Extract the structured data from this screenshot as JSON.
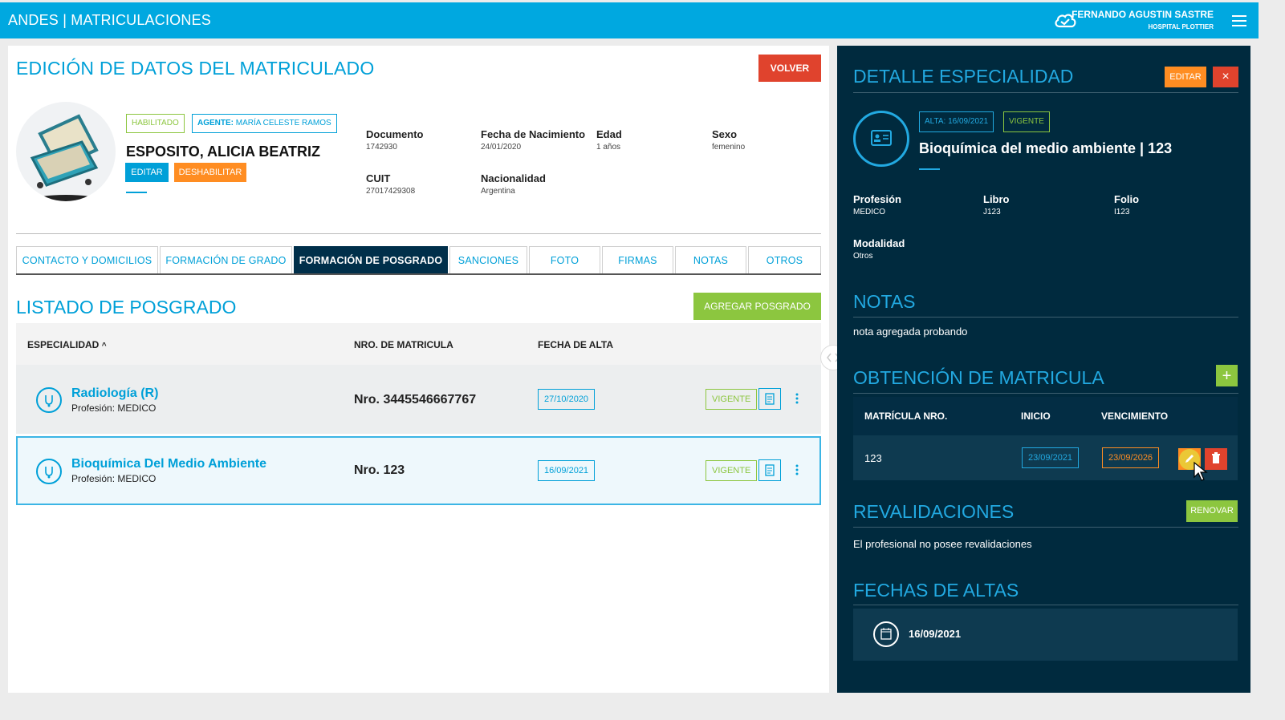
{
  "topbar": {
    "brand": "ANDES | MATRICULACIONES",
    "user_name": "FERNANDO AGUSTIN SASTRE",
    "user_org": "HOSPITAL PLOTTIER",
    "cloud_icon": "cloud-check-icon",
    "menu_icon": "hamburger-menu-icon"
  },
  "main": {
    "title": "EDICIÓN DE DATOS DEL MATRICULADO",
    "back_label": "VOLVER",
    "badges": {
      "status": "HABILITADO",
      "agent_label": "AGENTE:",
      "agent_name": "MARÍA CELESTE RAMOS"
    },
    "person_name": "ESPOSITO, ALICIA BEATRIZ",
    "edit_label": "EDITAR",
    "disable_label": "DESHABILITAR",
    "fields": {
      "documento": {
        "label": "Documento",
        "value": "1742930"
      },
      "nacimiento": {
        "label": "Fecha de Nacimiento",
        "value": "24/01/2020"
      },
      "edad": {
        "label": "Edad",
        "value": "1 años"
      },
      "sexo": {
        "label": "Sexo",
        "value": "femenino"
      },
      "cuit": {
        "label": "CUIT",
        "value": "27017429308"
      },
      "nacionalidad": {
        "label": "Nacionalidad",
        "value": "Argentina"
      }
    },
    "tabs": [
      {
        "label": "CONTACTO Y DOMICILIOS"
      },
      {
        "label": "FORMACIÓN DE GRADO"
      },
      {
        "label": "FORMACIÓN DE POSGRADO"
      },
      {
        "label": "SANCIONES"
      },
      {
        "label": "FOTO"
      },
      {
        "label": "FIRMAS"
      },
      {
        "label": "NOTAS"
      },
      {
        "label": "OTROS"
      }
    ],
    "list_title": "LISTADO DE POSGRADO",
    "add_label": "AGREGAR POSGRADO",
    "columns": {
      "especialidad": "ESPECIALIDAD",
      "sort_arrow": "^",
      "nro": "NRO. DE MATRICULA",
      "fecha": "FECHA DE ALTA"
    },
    "rows": [
      {
        "name": "Radiología (R)",
        "profesion": "Profesión: MEDICO",
        "nro": "Nro. 3445546667767",
        "fecha": "27/10/2020",
        "estado": "VIGENTE"
      },
      {
        "name": "Bioquímica Del Medio Ambiente",
        "profesion": "Profesión: MEDICO",
        "nro": "Nro. 123",
        "fecha": "16/09/2021",
        "estado": "VIGENTE"
      }
    ]
  },
  "detail": {
    "title": "DETALLE ESPECIALIDAD",
    "edit_label": "EDITAR",
    "close_label": "×",
    "alta_badge": "ALTA: 16/09/2021",
    "estado_badge": "VIGENTE",
    "specialty_title": "Bioquímica del medio ambiente | 123",
    "fields": {
      "profesion": {
        "label": "Profesión",
        "value": "MEDICO"
      },
      "libro": {
        "label": "Libro",
        "value": "J123"
      },
      "folio": {
        "label": "Folio",
        "value": "I123"
      },
      "modalidad": {
        "label": "Modalidad",
        "value": "Otros"
      }
    },
    "notas_title": "NOTAS",
    "nota_text": "nota agregada probando",
    "obtencion_title": "OBTENCIÓN DE MATRICULA",
    "add_symbol": "+",
    "mat_columns": {
      "nro": "MATRÍCULA NRO.",
      "inicio": "INICIO",
      "venc": "VENCIMIENTO"
    },
    "mat_row": {
      "nro": "123",
      "inicio": "23/09/2021",
      "venc": "23/09/2026"
    },
    "reval_title": "REVALIDACIONES",
    "renovar_label": "RENOVAR",
    "reval_text": "El profesional no posee revalidaciones",
    "fechas_title": "FECHAS DE ALTAS",
    "fecha_alta": "16/09/2021"
  },
  "colors": {
    "primary": "#00a8e0",
    "dark_panel": "#002a3e",
    "green": "#8cc63f",
    "orange": "#ff8d22",
    "red": "#e0432d"
  }
}
